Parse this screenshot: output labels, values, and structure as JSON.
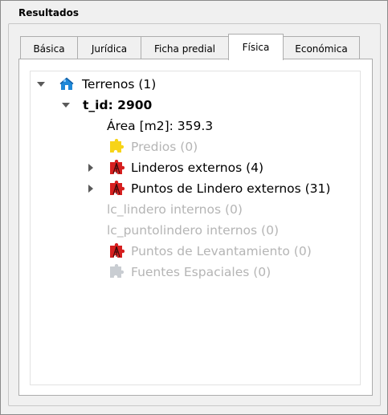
{
  "panel": {
    "title": "Resultados"
  },
  "tabs": [
    {
      "label": "Básica",
      "active": false
    },
    {
      "label": "Jurídica",
      "active": false
    },
    {
      "label": "Ficha predial",
      "active": false
    },
    {
      "label": "Física",
      "active": true
    },
    {
      "label": "Económica",
      "active": false
    }
  ],
  "tree": {
    "root": {
      "label": "Terrenos (1)",
      "icon": "house-icon",
      "expanded": true
    },
    "item": {
      "label": "t_id: 2900",
      "expanded": true
    },
    "area": {
      "label": "Área [m2]: 359.3"
    },
    "predios": {
      "label": "Predios (0)",
      "icon": "puzzle-yellow-icon",
      "enabled": false
    },
    "linderos": {
      "label": "Linderos externos (4)",
      "icon": "puzzle-red-icon",
      "enabled": true,
      "expanded": false
    },
    "puntos_lindero": {
      "label": "Puntos de Lindero externos (31)",
      "icon": "puzzle-red-icon",
      "enabled": true,
      "expanded": false
    },
    "lc_lindero": {
      "label": "lc_lindero internos (0)",
      "enabled": false
    },
    "lc_puntolindero": {
      "label": "lc_puntolindero internos (0)",
      "enabled": false
    },
    "puntos_levantamiento": {
      "label": "Puntos de Levantamiento (0)",
      "icon": "puzzle-red-icon",
      "enabled": false
    },
    "fuentes": {
      "label": "Fuentes Espaciales (0)",
      "icon": "puzzle-gray-icon",
      "enabled": false
    }
  },
  "colors": {
    "house_blue": "#1e88d8",
    "puzzle_yellow": "#f7d418",
    "puzzle_red": "#d61f1f",
    "puzzle_gray": "#c9cdd2",
    "disabled_text": "#b5b5b5"
  }
}
